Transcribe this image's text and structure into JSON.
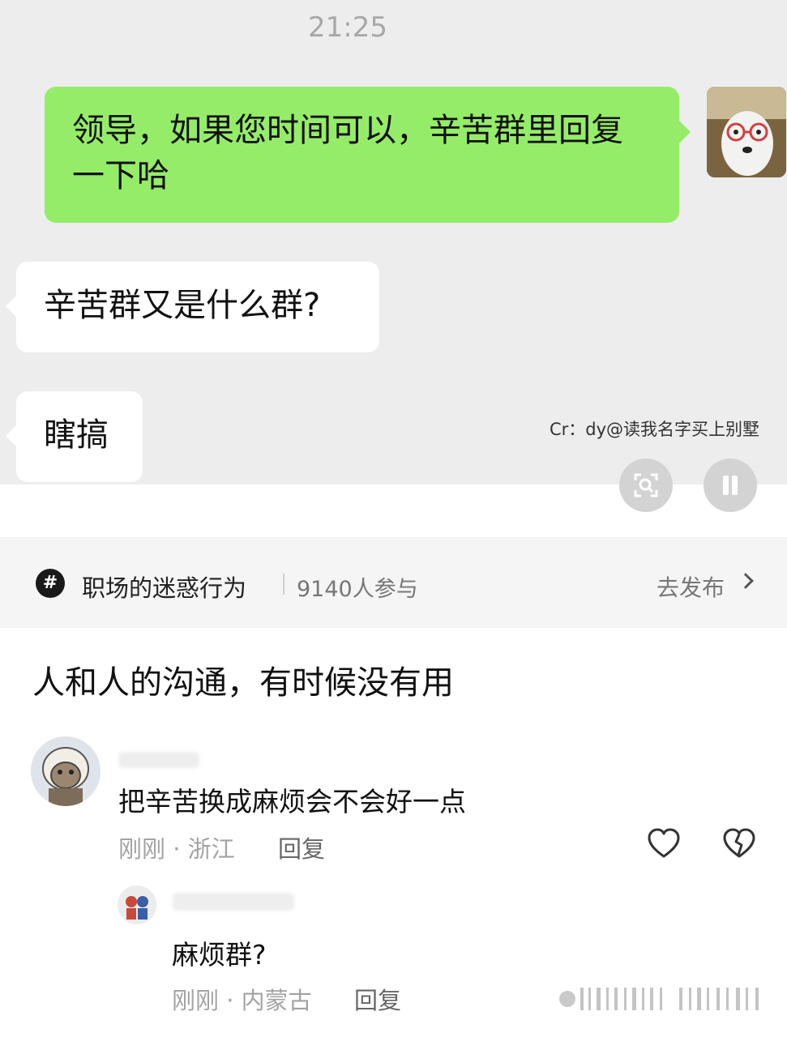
{
  "chat": {
    "time": "21:25",
    "outgoing_message": "领导，如果您时间可以，辛苦群里回复一下哈",
    "incoming_messages": [
      "辛苦群又是什么群?",
      "瞎搞"
    ],
    "credit": "Cr：dy@读我名字买上别墅"
  },
  "topic": {
    "icon": "#",
    "name": "职场的迷惑行为",
    "participants": "9140人参与",
    "action": "去发布"
  },
  "post": {
    "text": "人和人的沟通，有时候没有用"
  },
  "comments": [
    {
      "text": "把辛苦换成麻烦会不会好一点",
      "time": "刚刚",
      "location": "浙江",
      "reply_label": "回复"
    },
    {
      "text": "麻烦群?",
      "time": "刚刚",
      "location": "内蒙古",
      "reply_label": "回复"
    }
  ],
  "meta_separator": " · ",
  "colors": {
    "chat_bg": "#ededed",
    "outgoing_bubble": "#95ec69",
    "incoming_bubble": "#ffffff",
    "topic_bar_bg": "#f5f5f5"
  }
}
